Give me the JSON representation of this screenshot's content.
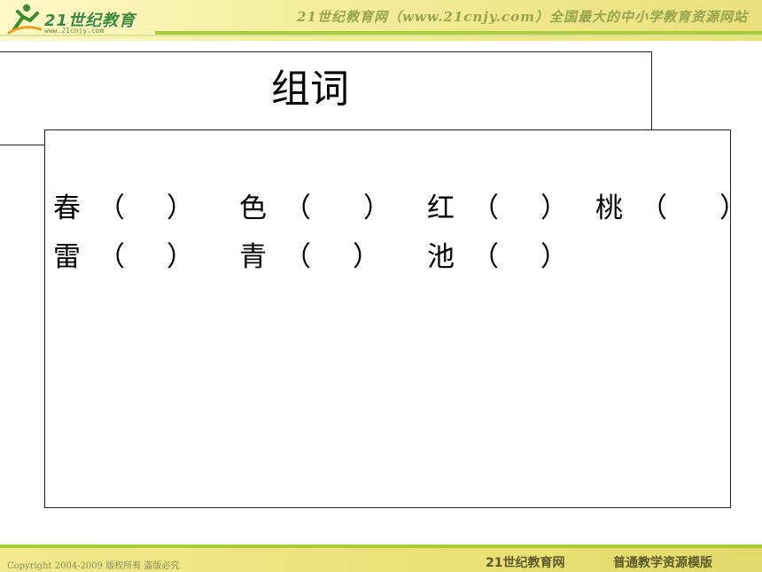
{
  "header": {
    "logo_text": "21世纪教育",
    "logo_url": "www.21cnjy.com",
    "slogan": "21世纪教育网（www.21cnjy.com）全国最大的中小学教育资源网站"
  },
  "slide": {
    "title": "组词",
    "rows": [
      [
        {
          "char": "春",
          "open": "（",
          "close": "）"
        },
        {
          "char": "色",
          "open": "（",
          "close": "）"
        },
        {
          "char": "红",
          "open": "（",
          "close": "）"
        },
        {
          "char": "桃",
          "open": "（",
          "close": "）"
        }
      ],
      [
        {
          "char": "雷",
          "open": "（",
          "close": "）"
        },
        {
          "char": "青",
          "open": "（",
          "close": "）"
        },
        {
          "char": "池",
          "open": "（",
          "close": "）"
        }
      ]
    ]
  },
  "footer": {
    "copyright": "Copyright 2004-2009 版权所有 盗版必究",
    "brand": "21世纪教育网",
    "template": "普通教学资源模版"
  },
  "colors": {
    "accent_green": "#a9cc3a",
    "header_yellow": "#f6eea0"
  }
}
